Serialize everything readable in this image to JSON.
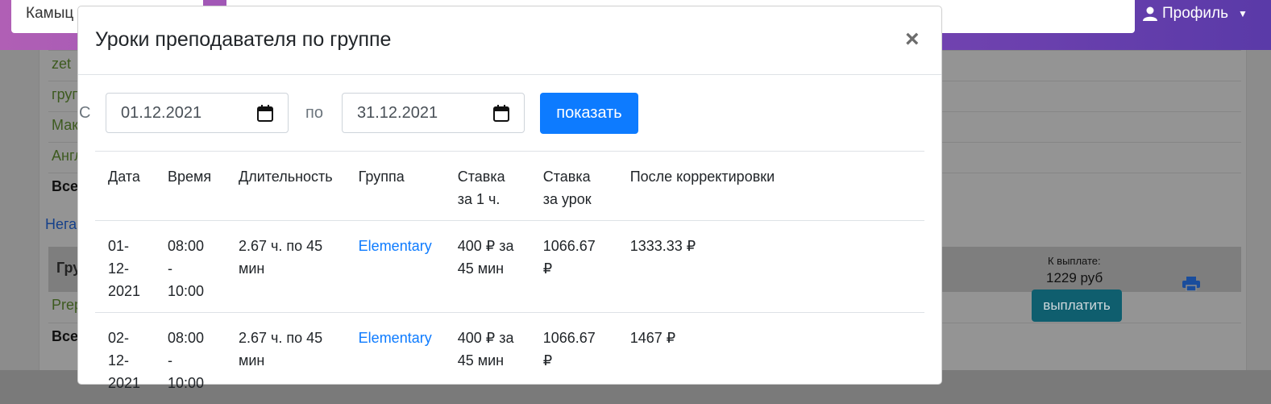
{
  "header": {
    "search_value": "Камыц",
    "profile_label": "Профиль"
  },
  "background": {
    "rows": [
      "zet",
      "груп",
      "Мак",
      "Англ",
      "Все"
    ],
    "link_text": "Нега",
    "table_header": "Гру",
    "group_row": "Prep",
    "total_row": "Все",
    "pay_label": "К выплате:",
    "pay_amount": "1229 руб",
    "pay_button": "выплатить"
  },
  "modal": {
    "title": "Уроки преподавателя по группе",
    "close": "×",
    "from_label": "С",
    "date_from": "01.12.2021",
    "to_label": "по",
    "date_to": "31.12.2021",
    "show_button": "показать",
    "columns": [
      "Дата",
      "Время",
      "Длительность",
      "Группа",
      "Ставка за 1 ч.",
      "Ставка за урок",
      "После корректировки"
    ],
    "rows": [
      {
        "date": "01-12-2021",
        "time": "08:00 - 10:00",
        "duration": "2.67 ч. по 45 мин",
        "group": "Elementary",
        "rate_hour": "400 ₽ за 45 мин",
        "rate_lesson": "1066.67 ₽",
        "adjusted": "1333.33 ₽"
      },
      {
        "date": "02-12-2021",
        "time": "08:00 - 10:00",
        "duration": "2.67 ч. по 45 мин",
        "group": "Elementary",
        "rate_hour": "400 ₽ за 45 мин",
        "rate_lesson": "1066.67 ₽",
        "adjusted": "1467 ₽"
      }
    ]
  },
  "colors": {
    "accent": "#0d7bff",
    "header_gradient_start": "#b05fb5",
    "header_gradient_end": "#5a3aa8"
  }
}
